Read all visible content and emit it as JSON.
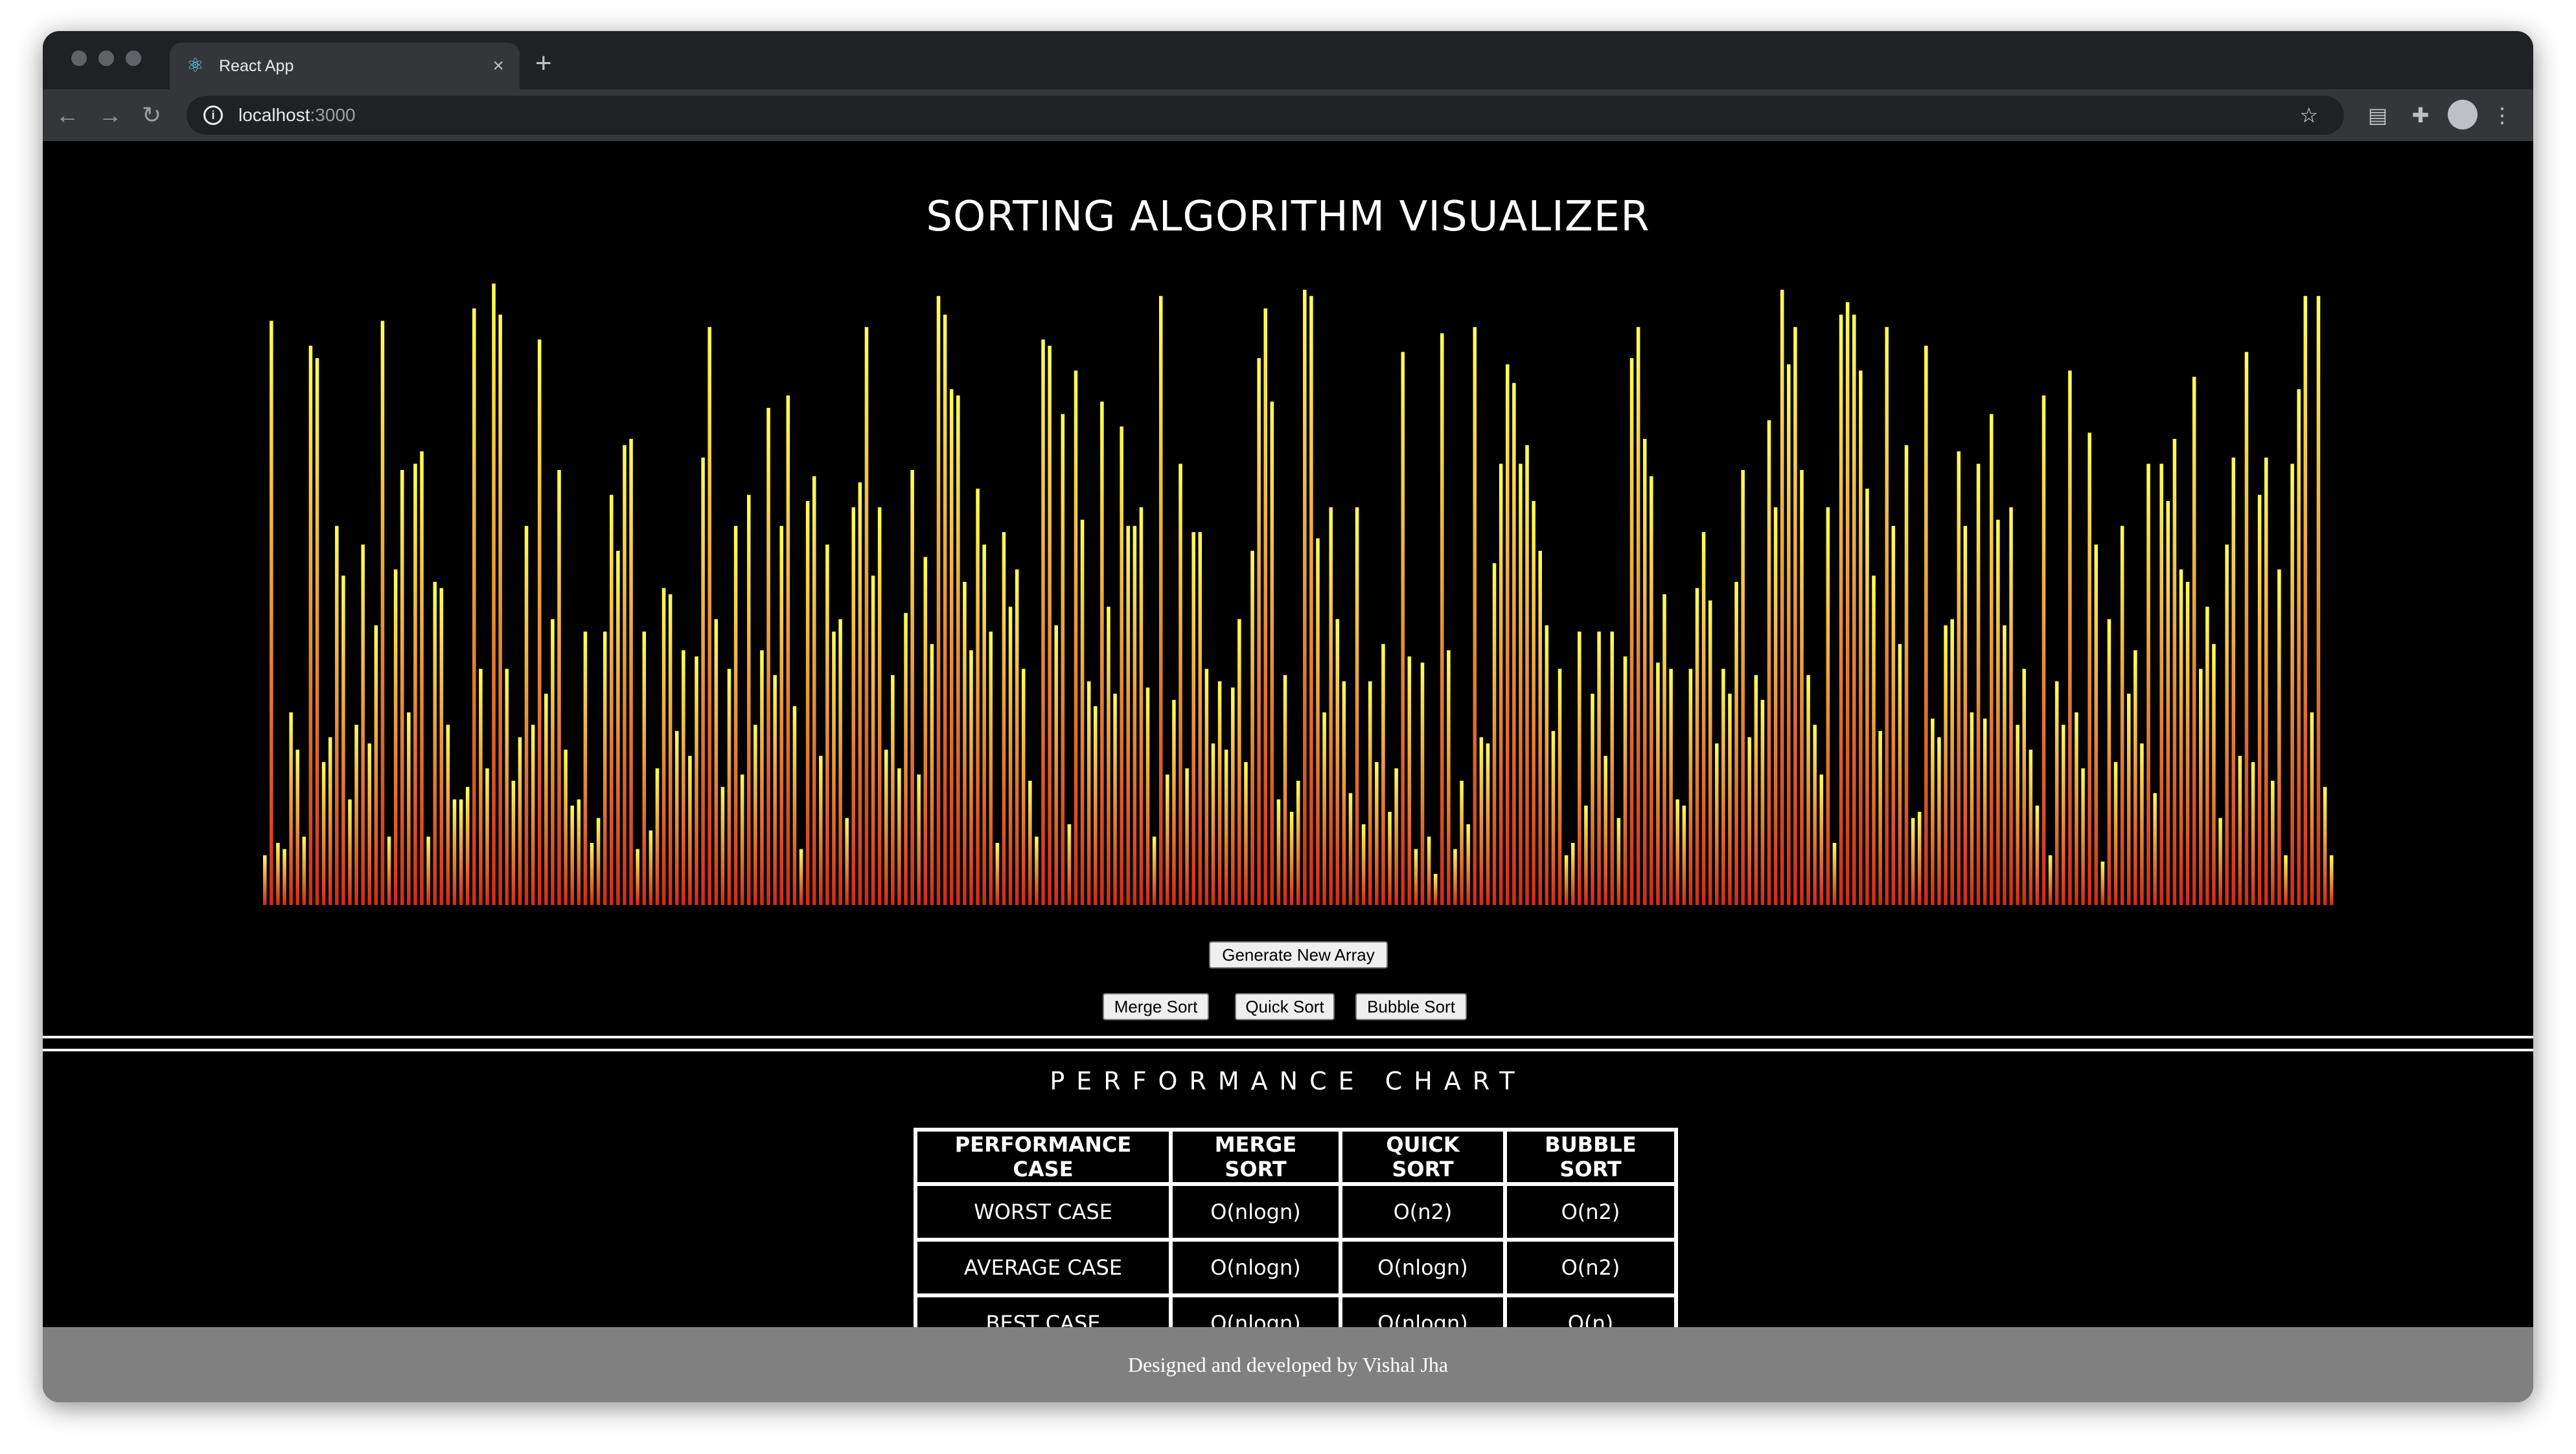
{
  "browser": {
    "tab_title": "React App",
    "url_host": "localhost",
    "url_port": ":3000",
    "icons": {
      "favicon": "react-icon",
      "close": "close-icon",
      "new_tab": "plus-icon",
      "back": "arrow-left-icon",
      "forward": "arrow-right-icon",
      "reload": "reload-icon",
      "info": "info-icon",
      "bookmark": "star-icon",
      "reading_list": "reading-list-icon",
      "extensions": "puzzle-icon",
      "profile": "avatar",
      "menu": "kebab-menu-icon"
    }
  },
  "page": {
    "title": "SORTING ALGORITHM VISUALIZER",
    "buttons": {
      "generate": "Generate New Array",
      "merge": "Merge Sort",
      "quick": "Quick Sort",
      "bubble": "Bubble Sort"
    },
    "array": {
      "colors": {
        "top": "#ffff55",
        "bottom": "#d02a1a"
      },
      "values": [
        8,
        94,
        10,
        9,
        31,
        25,
        11,
        90,
        88,
        23,
        27,
        61,
        53,
        17,
        29,
        58,
        26,
        45,
        94,
        11,
        54,
        70,
        31,
        71,
        73,
        11,
        52,
        51,
        29,
        17,
        17,
        19,
        96,
        38,
        22,
        100,
        95,
        38,
        20,
        27,
        61,
        29,
        91,
        34,
        46,
        70,
        25,
        16,
        17,
        44,
        10,
        14,
        44,
        66,
        57,
        74,
        75,
        9,
        44,
        12,
        22,
        51,
        50,
        28,
        41,
        24,
        40,
        72,
        93,
        46,
        19,
        38,
        61,
        21,
        66,
        29,
        41,
        80,
        37,
        61,
        82,
        32,
        9,
        65,
        69,
        24,
        58,
        44,
        46,
        14,
        64,
        68,
        93,
        53,
        64,
        25,
        37,
        22,
        47,
        70,
        21,
        56,
        42,
        98,
        95,
        83,
        82,
        52,
        41,
        67,
        58,
        44,
        10,
        60,
        48,
        54,
        38,
        20,
        11,
        91,
        90,
        45,
        79,
        13,
        86,
        62,
        36,
        32,
        81,
        48,
        34,
        77,
        61,
        61,
        64,
        35,
        11,
        98,
        21,
        33,
        71,
        22,
        60,
        60,
        38,
        26,
        36,
        25,
        35,
        46,
        23,
        57,
        88,
        96,
        81,
        17,
        37,
        15,
        20,
        99,
        98,
        59,
        31,
        64,
        46,
        36,
        18,
        64,
        13,
        36,
        23,
        42,
        15,
        22,
        89,
        40,
        9,
        39,
        11,
        5,
        92,
        41,
        9,
        20,
        13,
        93,
        27,
        26,
        55,
        71,
        87,
        84,
        71,
        74,
        65,
        57,
        45,
        28,
        38,
        8,
        10,
        44,
        16,
        34,
        44,
        24,
        44,
        14,
        40,
        88,
        93,
        75,
        69,
        39,
        50,
        38,
        17,
        16,
        38,
        51,
        60,
        49,
        26,
        38,
        34,
        52,
        70,
        27,
        37,
        33,
        78,
        64,
        99,
        87,
        93,
        70,
        37,
        29,
        21,
        64,
        10,
        95,
        97,
        95,
        86,
        67,
        53,
        28,
        93,
        61,
        42,
        74,
        14,
        15,
        90,
        30,
        27,
        45,
        46,
        73,
        61,
        31,
        71,
        30,
        79,
        62,
        45,
        64,
        29,
        38,
        25,
        16,
        82,
        8,
        36,
        29,
        86,
        31,
        22,
        76,
        58,
        7,
        46,
        23,
        61,
        34,
        41,
        26,
        71,
        18,
        71,
        65,
        75,
        54,
        52,
        85,
        38,
        48,
        42,
        14,
        58,
        72,
        24,
        89,
        23,
        66,
        72,
        20,
        54,
        8,
        71,
        83,
        98,
        31,
        98,
        19,
        8
      ]
    }
  },
  "performance": {
    "title": "PERFORMANCE CHART",
    "headers": [
      "PERFORMANCE CASE",
      "MERGE SORT",
      "QUICK SORT",
      "BUBBLE SORT"
    ],
    "rows": [
      {
        "case": "WORST CASE",
        "merge": "O(nlogn)",
        "quick": "O(n2)",
        "bubble": "O(n2)"
      },
      {
        "case": "AVERAGE CASE",
        "merge": "O(nlogn)",
        "quick": "O(nlogn)",
        "bubble": "O(n2)"
      },
      {
        "case": "BEST CASE",
        "merge": "O(nlogn)",
        "quick": "O(nlogn)",
        "bubble": "O(n)"
      }
    ]
  },
  "footer": {
    "text": "Designed and developed by Vishal Jha"
  }
}
